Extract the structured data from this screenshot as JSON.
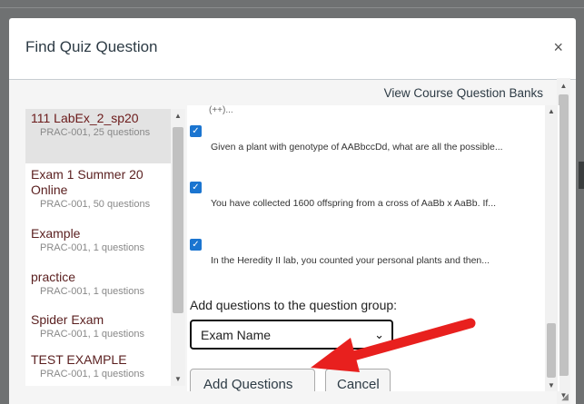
{
  "dialog": {
    "title": "Find Quiz Question",
    "close_glyph": "×",
    "view_banks_link": "View Course Question Banks"
  },
  "banks": [
    {
      "name": "111 LabEx_2_sp20",
      "meta": "PRAC-001, 25 questions",
      "selected": true
    },
    {
      "name": "Exam 1 Summer 20 Online",
      "meta": "PRAC-001, 50 questions"
    },
    {
      "name": "Example",
      "meta": "PRAC-001, 1 questions"
    },
    {
      "name": "practice",
      "meta": "PRAC-001, 1 questions"
    },
    {
      "name": "Spider Exam",
      "meta": "PRAC-001, 1 questions"
    },
    {
      "name": "TEST EXAMPLE",
      "meta": "PRAC-001, 1 questions"
    }
  ],
  "questions": {
    "partial_top": "(++)...",
    "items": [
      {
        "text": "Given a plant with genotype of AABbccDd, what are all the possible...",
        "checked": true
      },
      {
        "text": "You have collected 1600 offspring from a cross of AaBb x AaBb. If...",
        "checked": true
      },
      {
        "text": "In the Heredity II lab, you counted your personal plants and then...",
        "checked": true
      }
    ]
  },
  "group": {
    "label": "Add questions to the question group:",
    "selected": "Exam Name"
  },
  "buttons": {
    "add": "Add Questions",
    "cancel": "Cancel"
  },
  "icons": {
    "checkbox": "checkmark-icon",
    "select": "chevron-down-icon",
    "close": "close-icon"
  },
  "colors": {
    "checkbox": "#1b75d0",
    "annotation_arrow": "#e8201e"
  }
}
